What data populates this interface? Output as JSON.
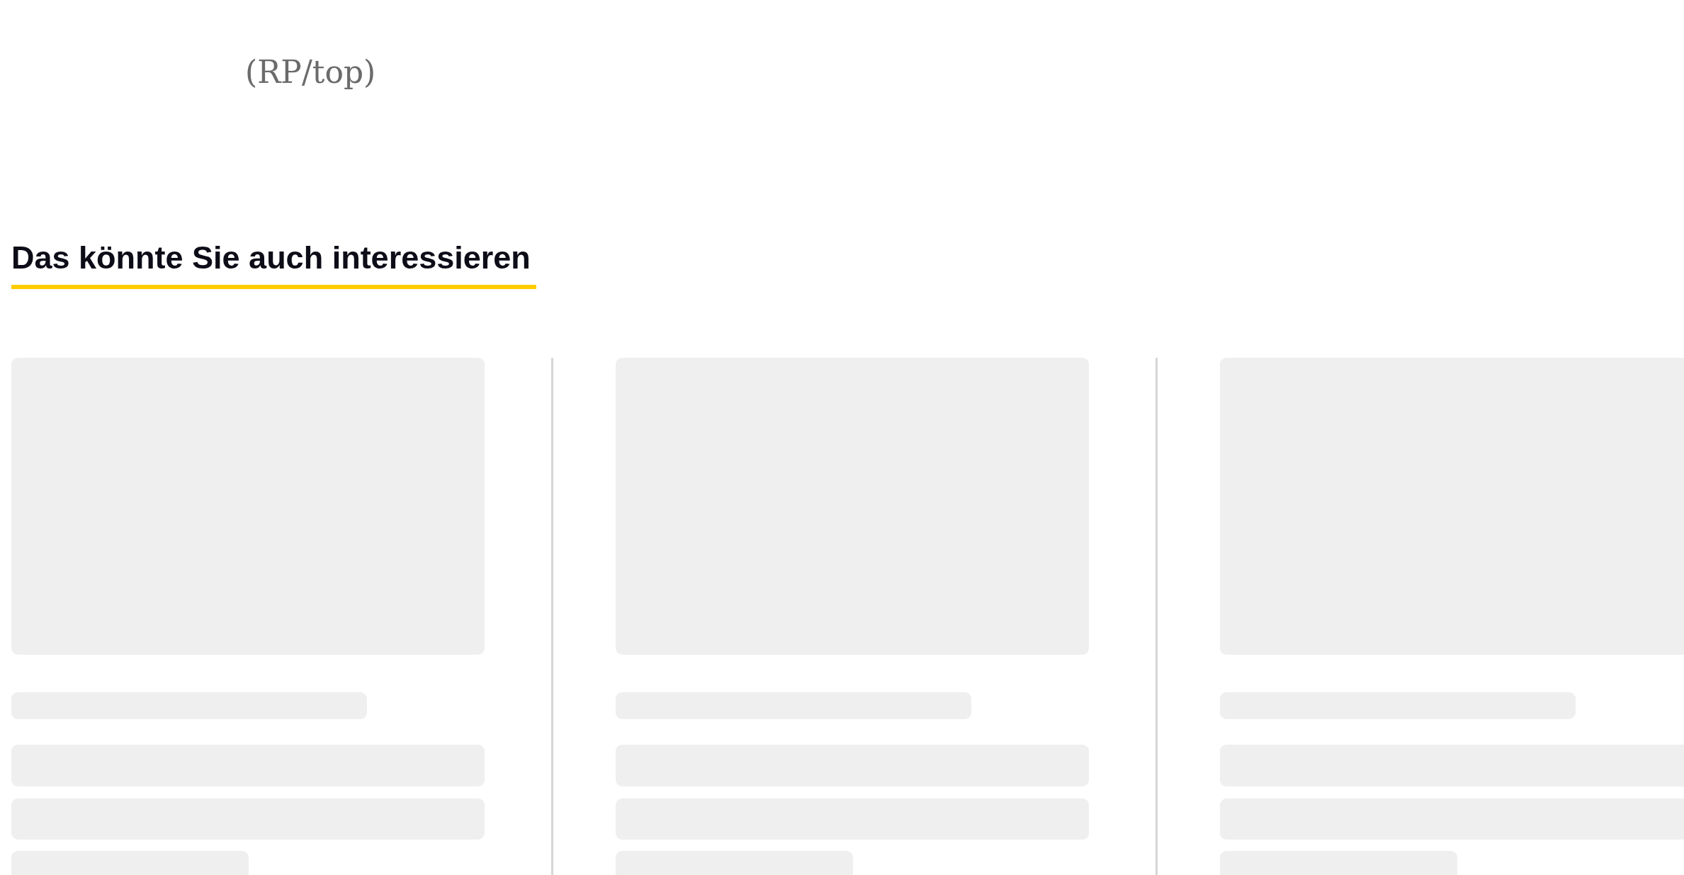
{
  "caption": "(RP/top)",
  "section": {
    "title": "Das könnte Sie auch interessieren",
    "cards": [
      {
        "kind": "skeleton"
      },
      {
        "kind": "skeleton"
      },
      {
        "kind": "skeleton"
      }
    ]
  }
}
